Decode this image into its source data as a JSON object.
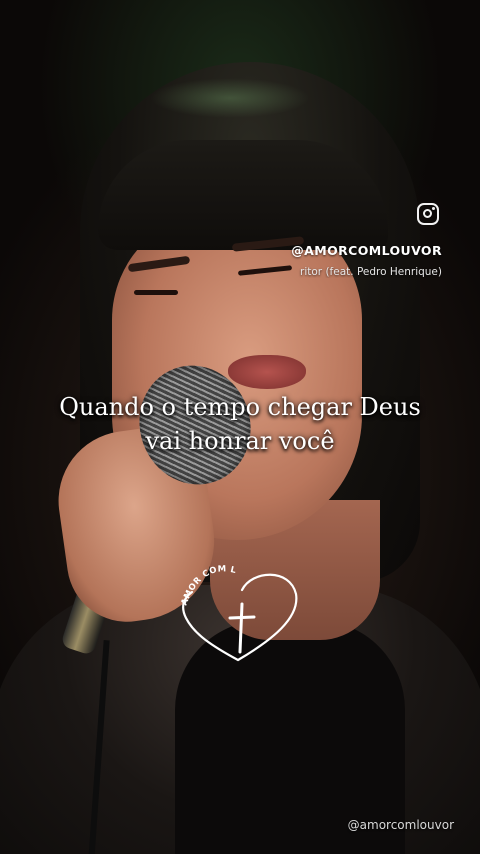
{
  "overlay": {
    "instagram_icon": "instagram-icon",
    "handle": "@AMORCOMLOUVOR",
    "song_credit": "ritor (feat. Pedro Henrique)",
    "lyrics": {
      "line1": "Quando o tempo chegar Deus",
      "line2": "vai honrar você"
    },
    "logo_text": "AMOR COM LOUVOR",
    "watermark": "@amorcomlouvor"
  },
  "colors": {
    "text": "#ffffff",
    "logo_stroke": "#ffffff"
  }
}
